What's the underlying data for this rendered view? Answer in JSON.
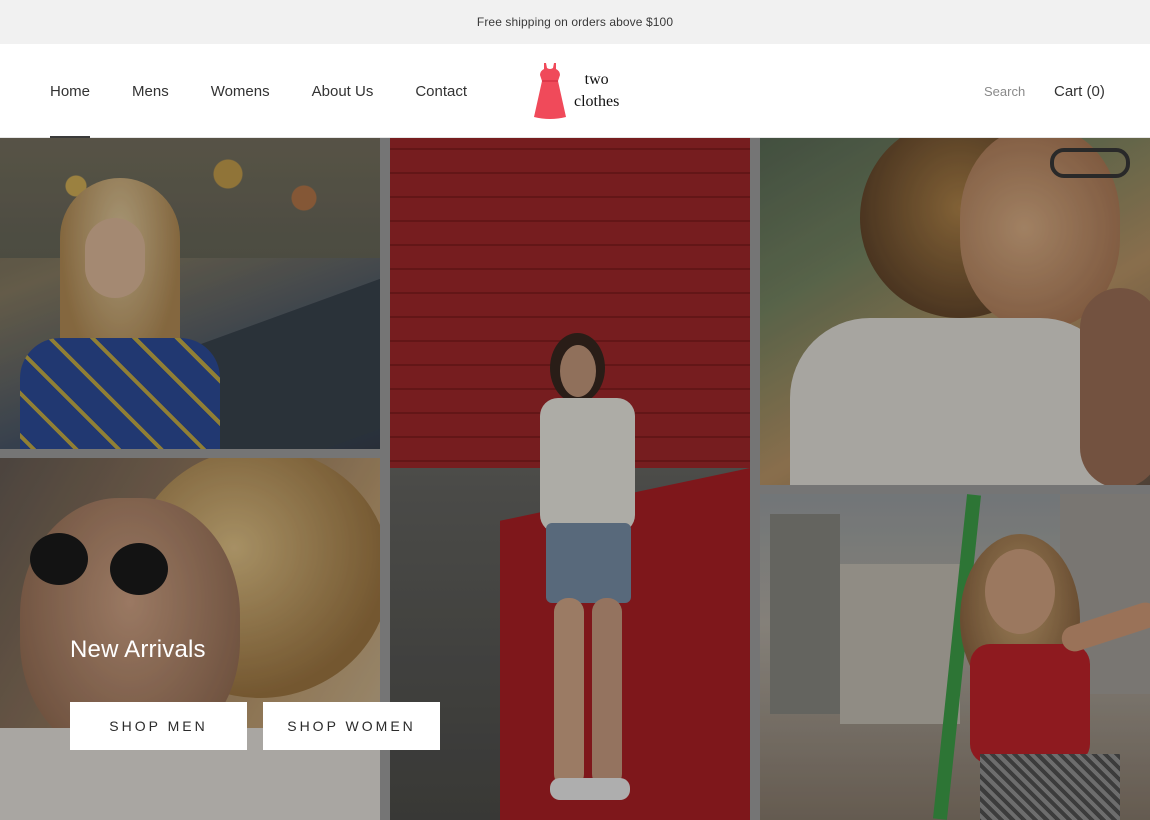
{
  "announcement": {
    "text": "Free shipping on orders above $100"
  },
  "nav": {
    "items": [
      {
        "label": "Home",
        "active": true
      },
      {
        "label": "Mens"
      },
      {
        "label": "Womens"
      },
      {
        "label": "About Us"
      },
      {
        "label": "Contact"
      }
    ]
  },
  "logo": {
    "line1": "two",
    "line2": "clothes",
    "icon": "dress-icon",
    "color": "#f04a5a"
  },
  "header_right": {
    "search_placeholder": "Search",
    "cart_label": "Cart (0)"
  },
  "hero": {
    "title": "New Arrivals",
    "buttons": {
      "men": "SHOP MEN",
      "women": "SHOP WOMEN"
    }
  }
}
